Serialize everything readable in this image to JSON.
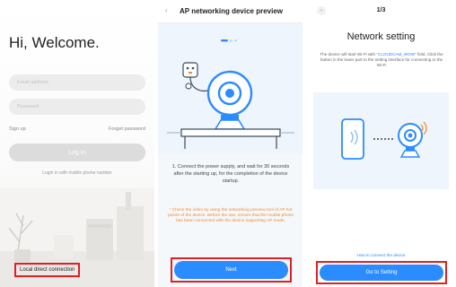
{
  "login": {
    "welcome": "Hi, Welcome.",
    "email_placeholder": "Email address",
    "password_placeholder": "Password",
    "signup_label": "Sign up",
    "forgot_label": "Forget password",
    "login_button": "Log In",
    "mobile_login": "Login in with mobile phone number",
    "local_direct": "Local direct connection"
  },
  "ap_preview": {
    "back_icon": "chevron-left-icon",
    "title": "AP networking device preview",
    "step_text": "1. Connect the power supply, and wait for 30 seconds after the starting up, for the completion of the device startup.",
    "warning": "* Check the video by using the networking preview tool of AP hot points of the device. Before the use, ensure that the mobile phone has been connected with the device supporting AP mode.",
    "next_button": "Next"
  },
  "network_setting": {
    "back_icon": "chevron-left-icon",
    "pager": "1/3",
    "title": "Network setting",
    "desc_prefix": "The device will start Wi-Fi with",
    "desc_highlight": "\"CLOUDCAM_WOW\"",
    "desc_suffix": "field. Click the button in the lower part to the setting interface for connecting to the Wi-Fi",
    "howto_link": "How to connect the device",
    "go_button": "Go to Setting"
  },
  "colors": {
    "accent": "#2a8cff",
    "highlight_border": "#e02020",
    "warning": "#f08a32"
  }
}
